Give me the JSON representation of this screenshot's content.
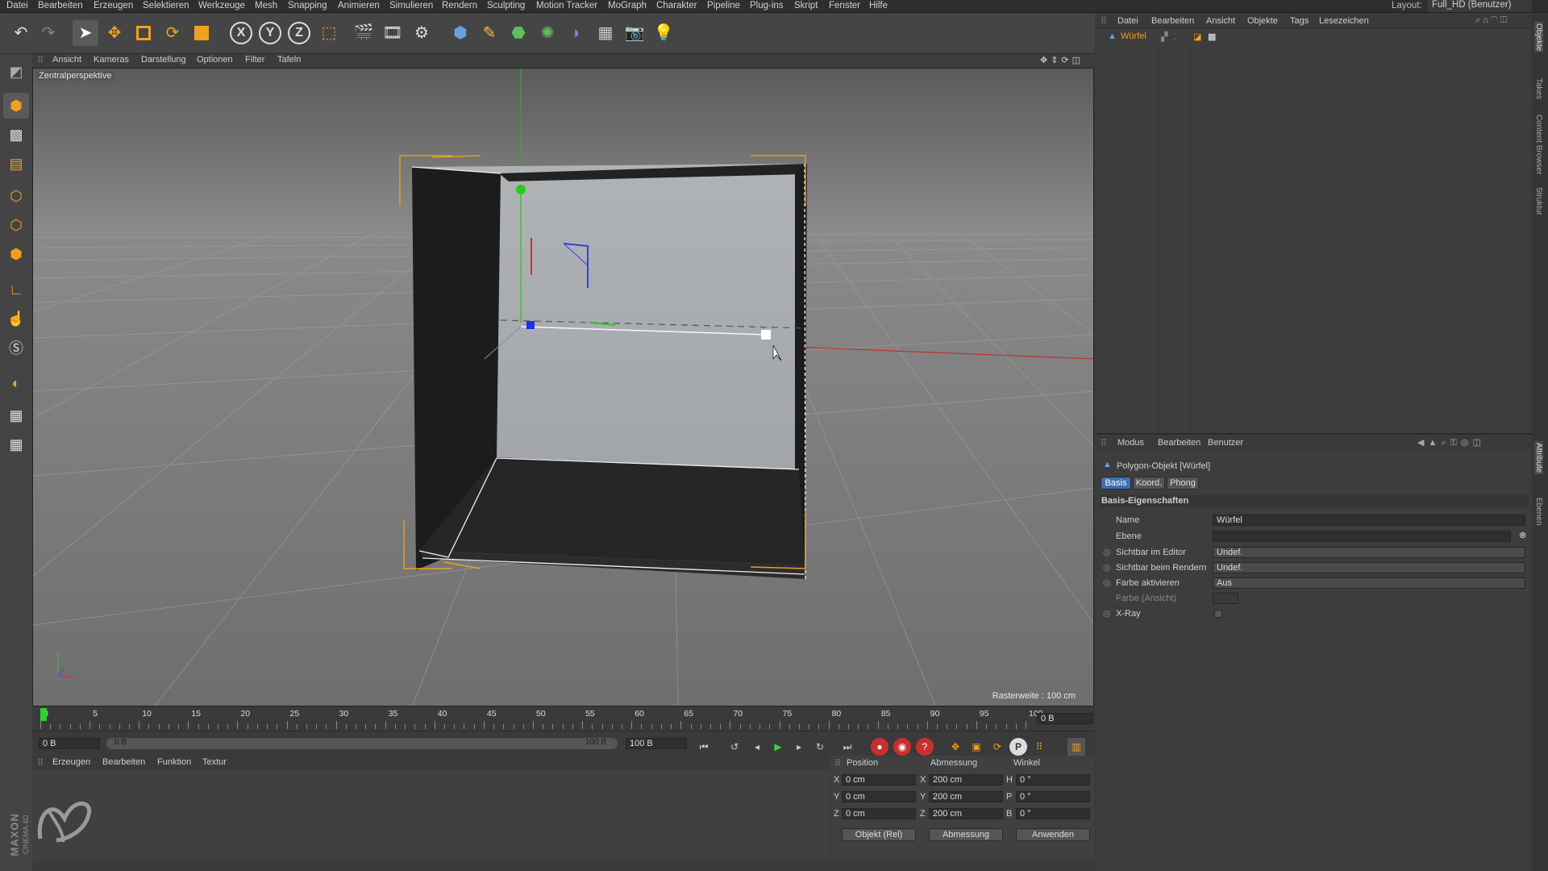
{
  "menubar": {
    "items": [
      "Datei",
      "Bearbeiten",
      "Erzeugen",
      "Selektieren",
      "Werkzeuge",
      "Mesh",
      "Snapping",
      "Animieren",
      "Simulieren",
      "Rendern",
      "Sculpting",
      "Motion Tracker",
      "MoGraph",
      "Charakter",
      "Pipeline",
      "Plug-ins",
      "Skript",
      "Fenster",
      "Hilfe"
    ],
    "layout_label": "Layout:",
    "layout_value": "Full_HD (Benutzer)"
  },
  "viewport": {
    "menu": [
      "Ansicht",
      "Kameras",
      "Darstellung",
      "Optionen",
      "Filter",
      "Tafeln"
    ],
    "camera_name": "Zentralperspektive",
    "grid_info": "Rasterweite : 100 cm"
  },
  "timeline": {
    "ticks": [
      "0",
      "5",
      "10",
      "15",
      "20",
      "25",
      "30",
      "35",
      "40",
      "45",
      "50",
      "55",
      "60",
      "65",
      "70",
      "75",
      "80",
      "85",
      "90",
      "95",
      "100"
    ],
    "current_frame": "0 B",
    "start_field": "0 B",
    "range_start": "0 B",
    "range_end": "100 B",
    "end_field": "100 B"
  },
  "material_panel": {
    "menu": [
      "Erzeugen",
      "Bearbeiten",
      "Funktion",
      "Textur"
    ],
    "brand_top": "MAXON",
    "brand_bottom": "CINEMA 4D"
  },
  "coords": {
    "headers": [
      "Position",
      "Abmessung",
      "Winkel"
    ],
    "rows": [
      {
        "axis": "X",
        "pos": "0 cm",
        "size_axis": "X",
        "size": "200 cm",
        "ang_axis": "H",
        "ang": "0 °"
      },
      {
        "axis": "Y",
        "pos": "0 cm",
        "size_axis": "Y",
        "size": "200 cm",
        "ang_axis": "P",
        "ang": "0 °"
      },
      {
        "axis": "Z",
        "pos": "0 cm",
        "size_axis": "Z",
        "size": "200 cm",
        "ang_axis": "B",
        "ang": "0 °"
      }
    ],
    "mode_select": "Objekt (Rel)",
    "size_select": "Abmessung",
    "apply_button": "Anwenden"
  },
  "object_manager": {
    "menu": [
      "Datei",
      "Bearbeiten",
      "Ansicht",
      "Objekte",
      "Tags",
      "Lesezeichen"
    ],
    "object_name": "Würfel"
  },
  "attribute_manager": {
    "menu": [
      "Modus",
      "Bearbeiten",
      "Benutzer"
    ],
    "object_title": "Polygon-Objekt [Würfel]",
    "tabs": [
      "Basis",
      "Koord.",
      "Phong"
    ],
    "section": "Basis-Eigenschaften",
    "props": [
      {
        "label": "Name",
        "value": "Würfel"
      },
      {
        "label": "Ebene",
        "value": ""
      },
      {
        "label": "Sichtbar im Editor",
        "value": "Undef."
      },
      {
        "label": "Sichtbar beim Rendern",
        "value": "Undef."
      },
      {
        "label": "Farbe aktivieren",
        "value": "Aus"
      },
      {
        "label": "Farbe (Ansicht)",
        "value": ""
      },
      {
        "label": "X-Ray",
        "value": ""
      }
    ]
  },
  "side_tabs": [
    "Objekte",
    "Takes",
    "Content Browser",
    "Struktur",
    "Attribute",
    "Ebenen"
  ],
  "colors": {
    "accent": "#3f6fb0",
    "selection_orange": "#e8a020",
    "axis_x": "#d03030",
    "axis_y": "#30c030",
    "axis_z": "#3040e0"
  }
}
